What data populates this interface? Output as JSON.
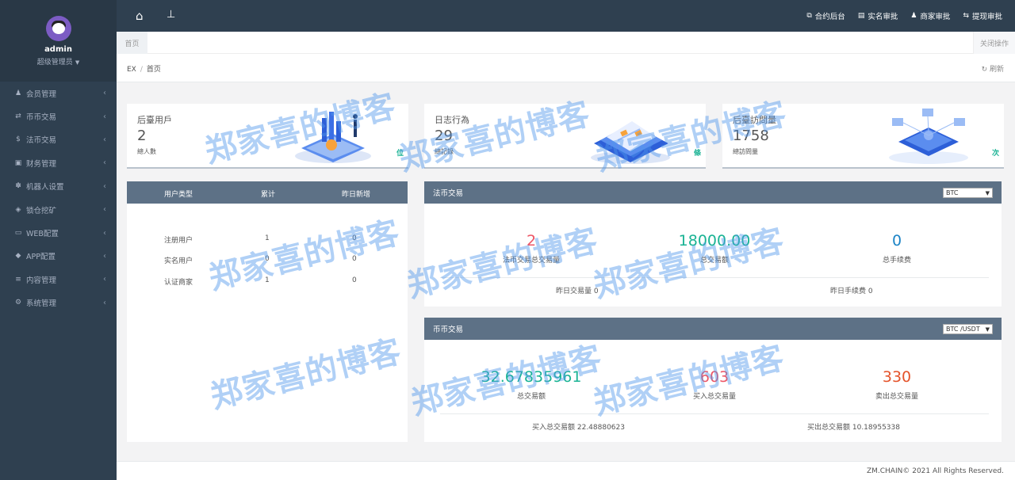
{
  "sidebar": {
    "user": {
      "name": "admin",
      "role": "超级管理员"
    },
    "items": [
      {
        "icon": "user-icon",
        "glyph": "♟",
        "label": "会员管理"
      },
      {
        "icon": "exchange-icon",
        "glyph": "⇄",
        "label": "币币交易"
      },
      {
        "icon": "dollar-icon",
        "glyph": "$",
        "label": "法币交易"
      },
      {
        "icon": "money-icon",
        "glyph": "▣",
        "label": "财务管理"
      },
      {
        "icon": "paw-icon",
        "glyph": "✽",
        "label": "机器人设置"
      },
      {
        "icon": "diamond-icon",
        "glyph": "◈",
        "label": "锁仓挖矿"
      },
      {
        "icon": "laptop-icon",
        "glyph": "▭",
        "label": "WEB配置"
      },
      {
        "icon": "android-icon",
        "glyph": "◆",
        "label": "APP配置"
      },
      {
        "icon": "list-icon",
        "glyph": "≡",
        "label": "内容管理"
      },
      {
        "icon": "cogs-icon",
        "glyph": "⚙",
        "label": "系统管理"
      }
    ]
  },
  "topbar": {
    "links": [
      {
        "icon": "external-link-icon",
        "glyph": "⧉",
        "label": "合约后台"
      },
      {
        "icon": "id-card-icon",
        "glyph": "▤",
        "label": "实名审批"
      },
      {
        "icon": "user-icon",
        "glyph": "♟",
        "label": "商家审批"
      },
      {
        "icon": "retweet-icon",
        "glyph": "⇆",
        "label": "提现审批"
      }
    ]
  },
  "tabs": {
    "home": "首页",
    "close_ops": "关闭操作"
  },
  "breadcrumb": {
    "root": "EX",
    "current": "首页",
    "refresh": "刷新"
  },
  "cards": [
    {
      "title": "后臺用戶",
      "value": "2",
      "sub": "總人數",
      "unit": "位"
    },
    {
      "title": "日志行為",
      "value": "29",
      "sub": "總記錄",
      "unit": "條"
    },
    {
      "title": "后臺訪問量",
      "value": "1758",
      "sub": "總訪問量",
      "unit": "次"
    }
  ],
  "user_table": {
    "headers": [
      "用户类型",
      "累计",
      "昨日新增"
    ],
    "rows": [
      {
        "type": "注册用户",
        "total": "1",
        "yesterday": "0"
      },
      {
        "type": "实名用户",
        "total": "0",
        "yesterday": "0"
      },
      {
        "type": "认证商家",
        "total": "1",
        "yesterday": "0"
      }
    ]
  },
  "fiat": {
    "title": "法币交易",
    "select": "BTC",
    "metrics": [
      {
        "value": "2",
        "label": "法币交易总交易量",
        "color": "#ed5565"
      },
      {
        "value": "18000.00",
        "label": "总交易额",
        "color": "#1ab394"
      },
      {
        "value": "0",
        "label": "总手续费",
        "color": "#1c84c6"
      }
    ],
    "footer": {
      "left": "昨日交易量 0",
      "right": "昨日手续费 0"
    }
  },
  "coin": {
    "title": "币币交易",
    "select": "BTC /USDT",
    "metrics": [
      {
        "value": "32.67835961",
        "label": "总交易额",
        "color": "#1ab394"
      },
      {
        "value": "603",
        "label": "买入总交易量",
        "color": "#ed5565"
      },
      {
        "value": "330",
        "label": "卖出总交易量",
        "color": "#e4532a"
      }
    ],
    "footer": {
      "left": "买入总交易额 22.48880623",
      "right": "买出总交易额 10.18955338"
    }
  },
  "footer": "ZM.CHAIN© 2021 All Rights Reserved.",
  "watermark": "郑家喜的博客"
}
